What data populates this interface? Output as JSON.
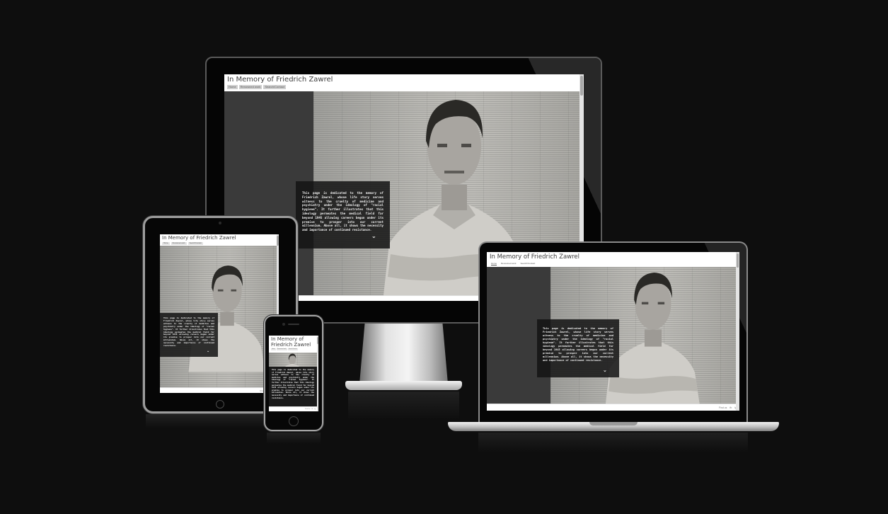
{
  "site": {
    "title": "In Memory of Friedrich Zawrel",
    "phone_title": "In Memory of Friedrich Zawrel",
    "nav": [
      "Home",
      "Renowned work",
      "Search/Contact"
    ],
    "intro": "This page is dedicated to the memory of Friedrich Zawrel, whose life story serves witness to the cruelty of medicine and psychiatry under the ideology of \"racial hygiene\". It further illustrates that this ideology permeates the medical field far beyond 1945 allowing careers begun under its premise to prosper into our current millennium. Above all, it shows the necessity and importance of continued resistance.",
    "chevron": "⌄",
    "footer_links": [
      "Find us",
      "fb",
      "ig"
    ]
  },
  "devices": {
    "monitor": "desktop",
    "tablet": "tablet",
    "phone": "phone",
    "laptop": "laptop"
  },
  "colors": {
    "background": "#0e0e0e",
    "overlay": "#141414",
    "hero_dark": "#3a3a3a"
  }
}
